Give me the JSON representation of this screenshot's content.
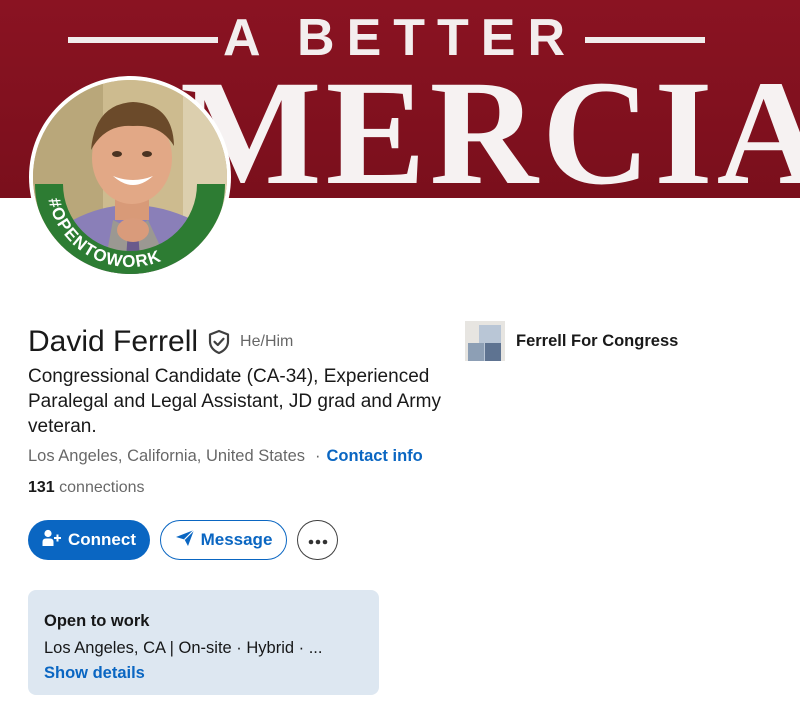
{
  "banner": {
    "top_text": "A BETTER",
    "big_text": "MERCIA",
    "bg_color": "#7f1120"
  },
  "avatar": {
    "frame_text": "#OPENTOWORK",
    "frame_color": "#2d7c33"
  },
  "profile": {
    "name": "David Ferrell",
    "verified_icon": "shield-check-icon",
    "pronouns": "He/Him",
    "headline": "Congressional Candidate (CA-34), Experienced Paralegal and Legal Assistant, JD grad and Army veteran.",
    "location": "Los Angeles, California, United States",
    "separator": "·",
    "contact_info_label": "Contact info",
    "connections_count": "131",
    "connections_label": "connections"
  },
  "actions": {
    "connect_label": "Connect",
    "connect_icon": "person-add-icon",
    "message_label": "Message",
    "message_icon": "paper-plane-icon",
    "more_icon": "ellipsis-icon"
  },
  "company": {
    "name": "Ferrell For Congress"
  },
  "open_to_work": {
    "title": "Open to work",
    "description": "Los Angeles, CA | On-site · Hybrid · ...",
    "link_label": "Show details"
  },
  "colors": {
    "primary": "#0a66c2",
    "card_bg": "#dde7f1"
  }
}
